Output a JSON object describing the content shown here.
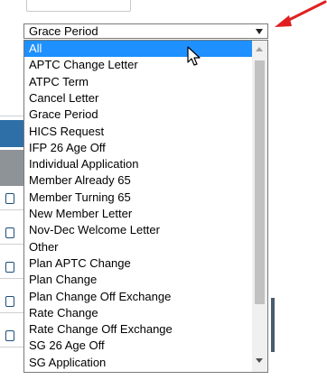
{
  "select": {
    "selected_value": "Grace Period",
    "arrow_icon": "chevron-down-icon"
  },
  "options": [
    "All",
    "APTC Change Letter",
    "ATPC Term",
    "Cancel Letter",
    "Grace Period",
    "HICS Request",
    "IFP 26 Age Off",
    "Individual Application",
    "Member Already 65",
    "Member Turning 65",
    "New Member Letter",
    "Nov-Dec Welcome Letter",
    "Other",
    "Plan APTC Change",
    "Plan Change",
    "Plan Change Off Exchange",
    "Rate Change",
    "Rate Change Off Exchange",
    "SG 26 Age Off",
    "SG Application"
  ],
  "highlighted_option_index": 0,
  "colors": {
    "highlight": "#1e90ff",
    "annotation_arrow": "#e02020"
  },
  "icons": {
    "cursor": "pointer-cursor-icon",
    "annotation": "red-arrow-annotation-icon",
    "scroll_up": "scroll-up-icon",
    "scroll_down": "scroll-down-icon"
  }
}
